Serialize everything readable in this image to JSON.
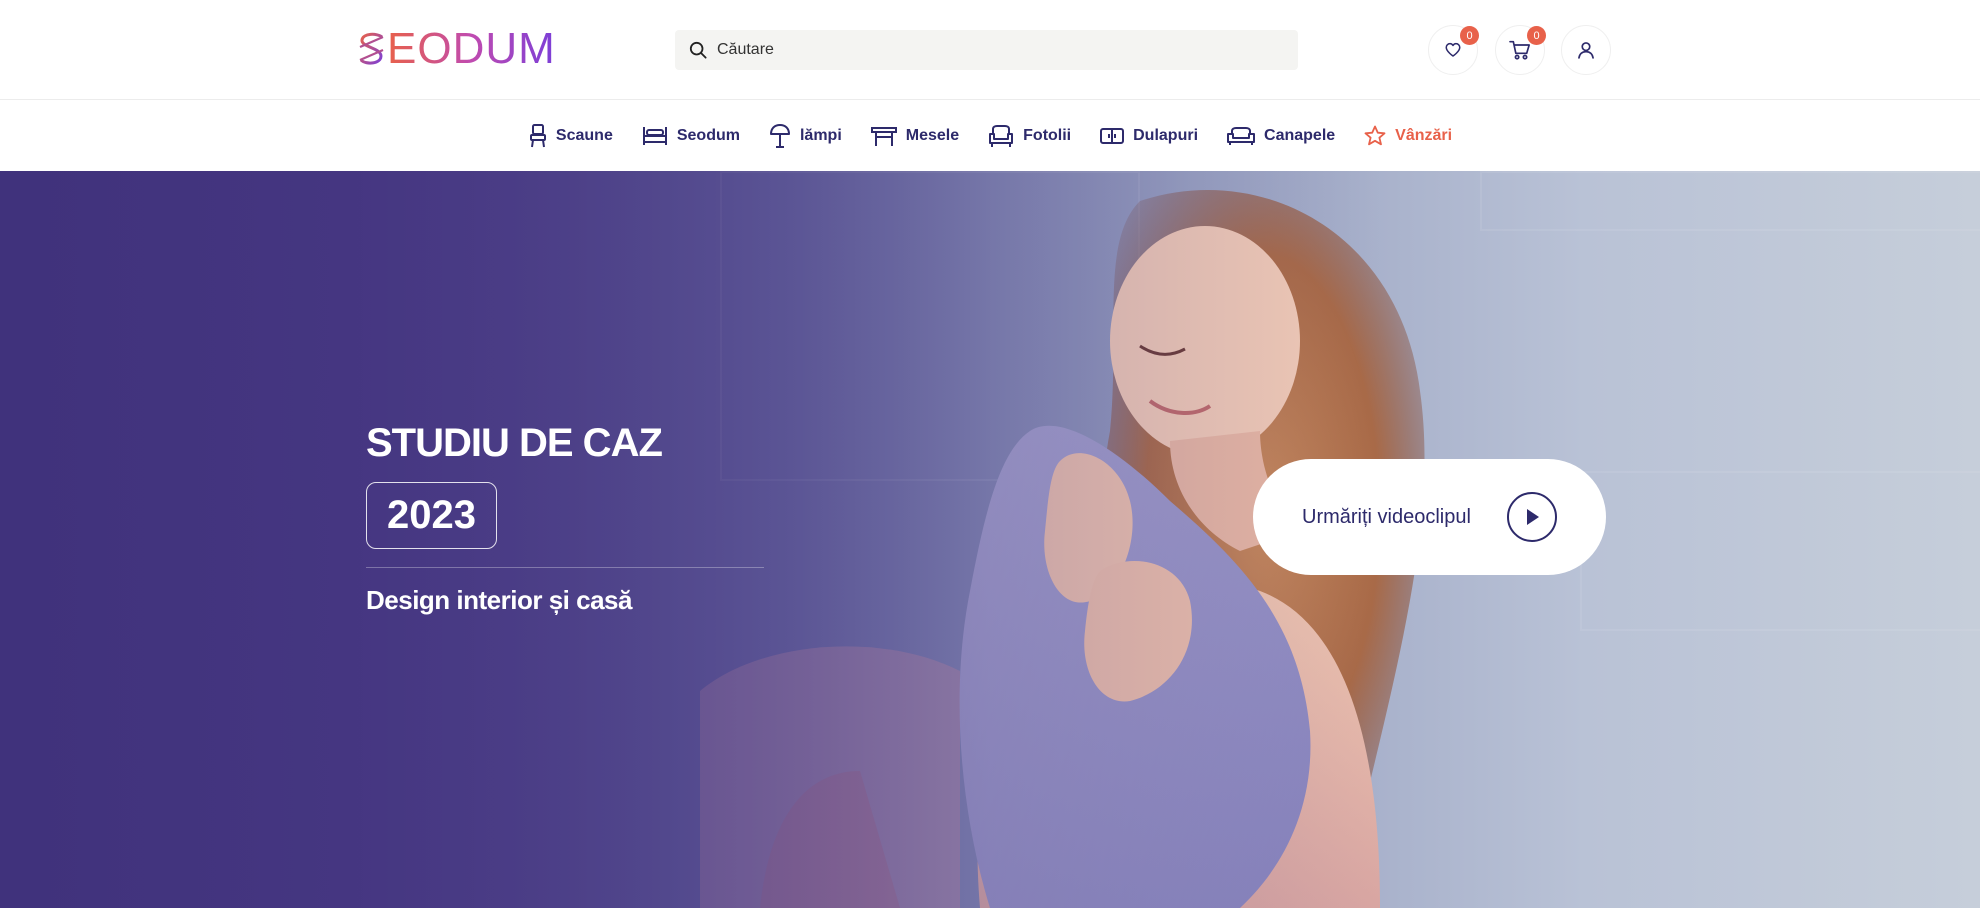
{
  "brand": {
    "logo_text": "EODUM"
  },
  "search": {
    "placeholder": "Căutare"
  },
  "header": {
    "wishlist_count": "0",
    "cart_count": "0"
  },
  "nav": {
    "items": [
      {
        "label": "Scaune",
        "icon": "chair-icon"
      },
      {
        "label": "Seodum",
        "icon": "bed-icon"
      },
      {
        "label": "lămpi",
        "icon": "lamp-icon"
      },
      {
        "label": "Mesele",
        "icon": "table-icon"
      },
      {
        "label": "Fotolii",
        "icon": "armchair-icon"
      },
      {
        "label": "Dulapuri",
        "icon": "wardrobe-icon"
      },
      {
        "label": "Canapele",
        "icon": "sofa-icon"
      },
      {
        "label": "Vânzări",
        "icon": "star-icon"
      }
    ]
  },
  "hero": {
    "title": "STUDIU DE CAZ",
    "year": "2023",
    "subtitle": "Design interior și casă",
    "video_label": "Urmăriți videoclipul"
  },
  "colors": {
    "primary": "#2d2a6b",
    "accent": "#e8614a",
    "hero_purple": "#40327c"
  }
}
